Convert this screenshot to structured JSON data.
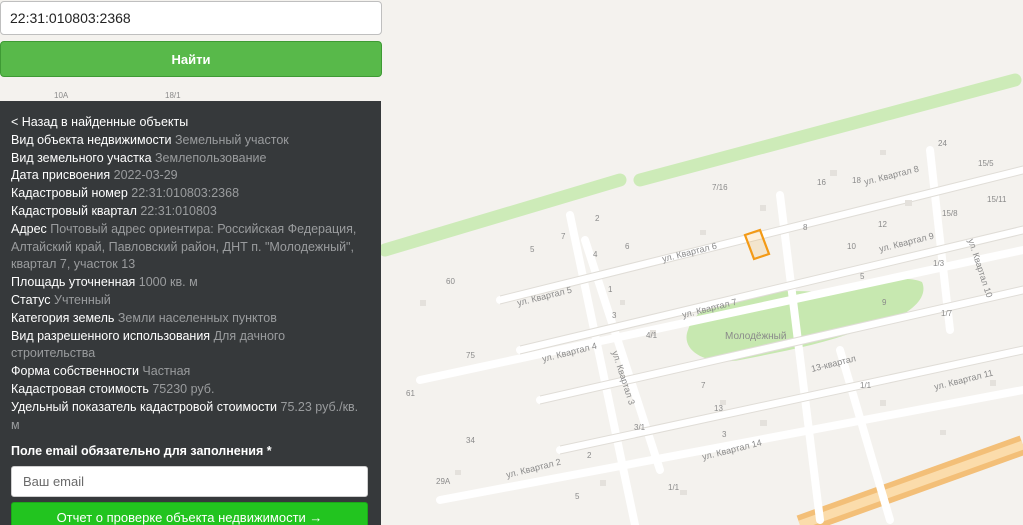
{
  "search": {
    "value": "22:31:010803:2368"
  },
  "find_button": {
    "label": "Найти"
  },
  "panel": {
    "back_link": "< Назад в найденные объекты",
    "fields": [
      {
        "label": "Вид объекта недвижимости",
        "value": "Земельный участок"
      },
      {
        "label": "Вид земельного участка",
        "value": "Землепользование"
      },
      {
        "label": "Дата присвоения",
        "value": "2022-03-29"
      },
      {
        "label": "Кадастровый номер",
        "value": "22:31:010803:2368"
      },
      {
        "label": "Кадастровый квартал",
        "value": "22:31:010803"
      },
      {
        "label": "Адрес",
        "value": "Почтовый адрес ориентира: Российская Федерация, Алтайский край, Павловский район, ДНТ п. \"Молодежный\", квартал 7, участок 13"
      },
      {
        "label": "Площадь уточненная",
        "value": "1000 кв. м"
      },
      {
        "label": "Статус",
        "value": "Учтенный"
      },
      {
        "label": "Категория земель",
        "value": "Земли населенных пунктов"
      },
      {
        "label": "Вид разрешенного использования",
        "value": "Для дачного строительства"
      },
      {
        "label": "Форма собственности",
        "value": "Частная"
      },
      {
        "label": "Кадастровая стоимость",
        "value": "75230 руб."
      },
      {
        "label": "Удельный показатель кадастровой стоимости",
        "value": "75.23 руб./кв. м"
      }
    ],
    "email_label": "Поле email обязательно для заполнения *",
    "email_placeholder": "Ваш email",
    "report_button": "Отчет о проверке объекта недвижимости →"
  },
  "map": {
    "place_name": "Молодёжный",
    "streets": [
      "ул. Квартал 6",
      "ул. Квартал 8",
      "ул. Квартал 9",
      "ул. Квартал 10",
      "ул. Квартал 5",
      "ул. Квартал 7",
      "ул. Квартал 4",
      "ул. Квартал 3",
      "13-квартал",
      "ул. Квартал 11",
      "ул. Квартал 14",
      "ул. Квартал 2"
    ],
    "house_numbers": [
      "10A",
      "18/1",
      "60",
      "75",
      "61",
      "34",
      "29A",
      "7/16",
      "2",
      "7",
      "5",
      "4",
      "6",
      "1",
      "3",
      "8",
      "10",
      "12",
      "16",
      "18",
      "24",
      "15/5",
      "15/11",
      "15/8",
      "1/3",
      "1/7",
      "5",
      "9",
      "4/1",
      "3/1",
      "7",
      "13",
      "1/1",
      "1/1",
      "2",
      "3",
      "5"
    ],
    "colors": {
      "background": "#f4f2ee",
      "road": "#ffffff",
      "green": "#c9e9b3",
      "park": "#c5e7ae",
      "parcel": "#f39a16",
      "highway": "#f5c27a"
    }
  }
}
